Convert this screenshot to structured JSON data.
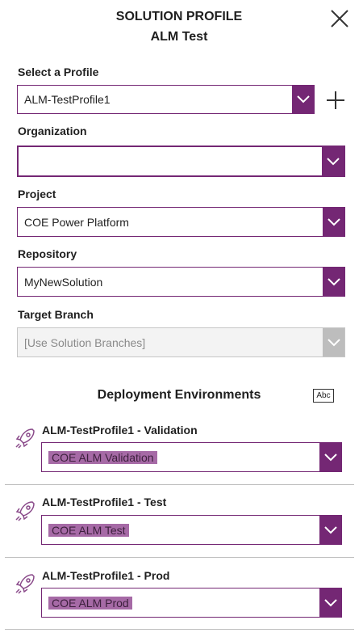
{
  "header": {
    "title": "SOLUTION PROFILE",
    "subtitle": "ALM Test",
    "close_icon": "close-icon"
  },
  "profile": {
    "label": "Select a Profile",
    "value": "ALM-TestProfile1",
    "add_icon": "plus-icon"
  },
  "organization": {
    "label": "Organization",
    "value": ""
  },
  "project": {
    "label": "Project",
    "value": "COE Power Platform"
  },
  "repository": {
    "label": "Repository",
    "value": "MyNewSolution"
  },
  "target_branch": {
    "label": "Target Branch",
    "value": "[Use Solution Branches]"
  },
  "deployment": {
    "title": "Deployment Environments",
    "abc_badge": "Abc",
    "environments": [
      {
        "label": "ALM-TestProfile1 - Validation",
        "value": "COE ALM Validation",
        "icon": "rocket-icon"
      },
      {
        "label": "ALM-TestProfile1 - Test",
        "value": "COE ALM Test",
        "icon": "rocket-icon"
      },
      {
        "label": "ALM-TestProfile1 - Prod",
        "value": "COE ALM Prod",
        "icon": "rocket-icon"
      }
    ]
  },
  "colors": {
    "accent": "#742774",
    "highlight": "#a66aa6",
    "disabled": "#bdbdbd"
  }
}
